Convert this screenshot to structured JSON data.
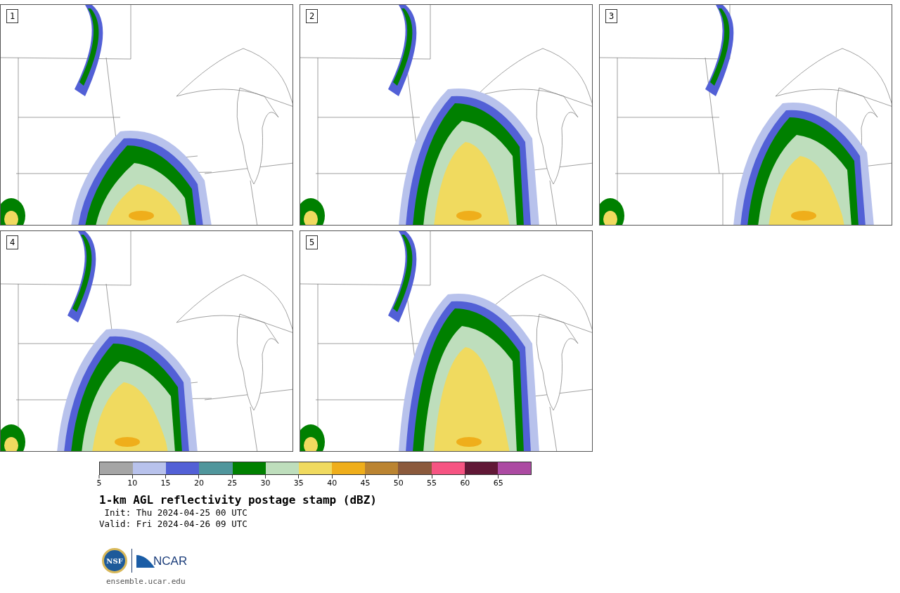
{
  "panels": [
    {
      "label": "1"
    },
    {
      "label": "2"
    },
    {
      "label": "3"
    },
    {
      "label": "4"
    },
    {
      "label": "5"
    }
  ],
  "colorbar": {
    "bins": [
      {
        "color": "#a5a5a5"
      },
      {
        "color": "#b8c2ec"
      },
      {
        "color": "#5260d6"
      },
      {
        "color": "#50969c"
      },
      {
        "color": "#008000"
      },
      {
        "color": "#bedebc"
      },
      {
        "color": "#f0da5f"
      },
      {
        "color": "#efae1b"
      },
      {
        "color": "#bb8431"
      },
      {
        "color": "#8b5a3c"
      },
      {
        "color": "#f65482"
      },
      {
        "color": "#611836"
      },
      {
        "color": "#ac4aa2"
      }
    ],
    "ticks": [
      "5",
      "10",
      "15",
      "20",
      "25",
      "30",
      "35",
      "40",
      "45",
      "50",
      "55",
      "60",
      "65"
    ]
  },
  "title": "1-km AGL reflectivity postage stamp (dBZ)",
  "init": " Init: Thu 2024-04-25 00 UTC",
  "valid": "Valid: Fri 2024-04-26 09 UTC",
  "logo": {
    "nsf": "NSF",
    "ncar": "NCAR"
  },
  "site": "ensemble.ucar.edu"
}
